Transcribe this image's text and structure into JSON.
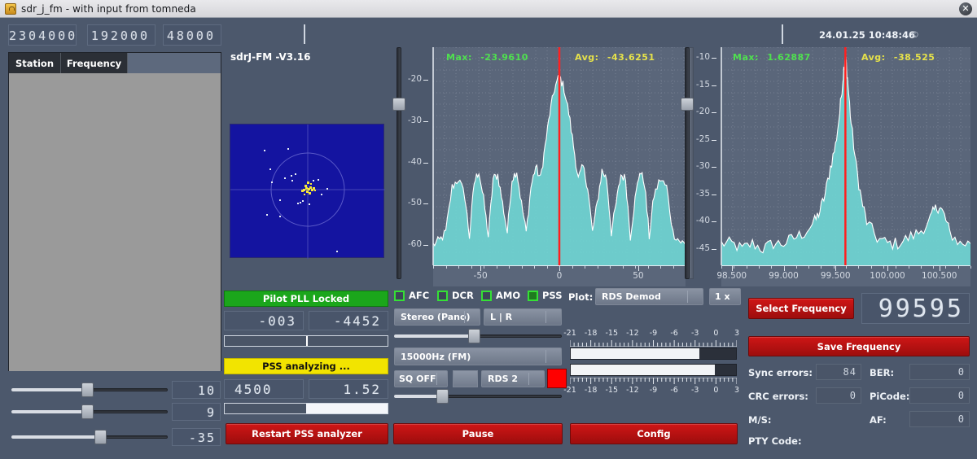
{
  "window": {
    "title": "sdr_j_fm - with input from tomneda",
    "close_label": "✕",
    "app_icon": "lock-icon"
  },
  "header": {
    "rate_displays": [
      "2304000",
      "192000",
      "48000"
    ],
    "version": "sdrJ-FM -V3.16",
    "datetime": "24.01.25 10:48:46",
    "copyright": "©"
  },
  "station_table": {
    "columns": [
      "Station",
      "Frequency"
    ],
    "rows": []
  },
  "left_sliders": [
    {
      "name": "slider-1",
      "value": "10",
      "pct": 47
    },
    {
      "name": "slider-2",
      "value": "9",
      "pct": 47
    },
    {
      "name": "slider-3",
      "value": "-35",
      "pct": 55
    }
  ],
  "constellation": {
    "label": "constellation-scope",
    "bg": "#1414a0",
    "point_color": "#f7e73a"
  },
  "status": {
    "pll": {
      "text": "Pilot PLL Locked",
      "color": "#1ba61b"
    },
    "pll_value_left": "-003",
    "pll_value_right": "-4452",
    "pll_bar_pct": 50,
    "pss": {
      "text": "PSS analyzing ...",
      "color": "#f2e400"
    },
    "pss_value_left": "4500",
    "pss_value_right": "1.52",
    "pss_bar_pct": 50
  },
  "toggles": [
    {
      "label": "AFC",
      "checked": false
    },
    {
      "label": "DCR",
      "checked": false
    },
    {
      "label": "AMO",
      "checked": false
    },
    {
      "label": "PSS",
      "checked": true
    }
  ],
  "plot_controls": {
    "plot_label": "Plot:",
    "plot_mode": "RDS Demod",
    "zoom": "1 x",
    "stereo_mode": "Stereo (Pano)",
    "channel_mode": "L | R",
    "filter": "15000Hz (FM)",
    "squelch": "SQ OFF",
    "rds_mode": "RDS 2",
    "rds_indicator_color": "#ff0000",
    "balance_pct": 45,
    "squelch_slider_pct": 26
  },
  "level_meters": {
    "tick_labels": [
      "-21",
      "-18",
      "-15",
      "-12",
      "-9",
      "-6",
      "-3",
      "0",
      "3"
    ],
    "left_pct": 78,
    "right_pct": 87
  },
  "frequency": {
    "select_label": "Select Frequency",
    "save_label": "Save Frequency",
    "display": "99595"
  },
  "rds_stats": [
    {
      "label": "Sync errors:",
      "value": "84"
    },
    {
      "label": "BER:",
      "value": "0"
    },
    {
      "label": "CRC errors:",
      "value": "0"
    },
    {
      "label": "PiCode:",
      "value": "0"
    },
    {
      "label": "M/S:",
      "value": ""
    },
    {
      "label": "AF:",
      "value": "0"
    },
    {
      "label": "PTY Code:",
      "value": ""
    }
  ],
  "actions": {
    "restart": "Restart PSS analyzer",
    "pause": "Pause",
    "config": "Config"
  },
  "chart_data": [
    {
      "type": "area",
      "name": "baseband-spectrum",
      "title": "",
      "xlabel": "",
      "ylabel": "",
      "stat_max_label": "Max:",
      "stat_max_value": "-23.9610",
      "stat_avg_label": "Avg:",
      "stat_avg_value": "-43.6251",
      "xlim": [
        -80,
        80
      ],
      "ylim": [
        -65,
        -12
      ],
      "xticks": [
        -50,
        0,
        50
      ],
      "yticks": [
        -20,
        -30,
        -40,
        -50,
        -60
      ],
      "grid": true,
      "marker_x": 0,
      "marker_color": "#ff2020",
      "fill_color": "#6fd9d6",
      "line_color": "#ffffff",
      "x": [
        -80,
        -76,
        -72,
        -68,
        -64,
        -60,
        -57,
        -54,
        -51,
        -48,
        -45,
        -42,
        -39,
        -36,
        -33,
        -30,
        -27,
        -24,
        -21,
        -18,
        -15,
        -12,
        -9,
        -6,
        -3,
        0,
        3,
        6,
        9,
        12,
        15,
        18,
        21,
        24,
        27,
        30,
        33,
        36,
        39,
        42,
        45,
        48,
        51,
        54,
        57,
        60,
        64,
        68,
        72,
        76,
        80
      ],
      "y": [
        -60,
        -59,
        -57,
        -46,
        -44,
        -48,
        -58,
        -45,
        -42,
        -49,
        -58,
        -44,
        -43,
        -50,
        -57,
        -44,
        -42,
        -50,
        -57,
        -46,
        -41,
        -44,
        -36,
        -28,
        -22,
        -19,
        -22,
        -28,
        -36,
        -44,
        -41,
        -46,
        -57,
        -50,
        -42,
        -44,
        -57,
        -50,
        -43,
        -44,
        -58,
        -49,
        -42,
        -45,
        -58,
        -48,
        -44,
        -46,
        -57,
        -59,
        -60
      ]
    },
    {
      "type": "area",
      "name": "rf-spectrum",
      "title": "",
      "xlabel": "",
      "ylabel": "",
      "stat_max_label": "Max:",
      "stat_max_value": "1.62887",
      "stat_avg_label": "Avg:",
      "stat_avg_value": "-38.525",
      "xlim": [
        98.4,
        100.8
      ],
      "ylim": [
        -48,
        -8
      ],
      "xticks": [
        "98.500",
        "99.000",
        "99.500",
        "100.000",
        "100.500"
      ],
      "yticks": [
        -10,
        -15,
        -20,
        -25,
        -30,
        -35,
        -40,
        -45
      ],
      "grid": true,
      "marker_x": 99.595,
      "marker_color": "#ff2020",
      "fill_color": "#6fd9d6",
      "line_color": "#ffffff",
      "x": [
        98.4,
        98.5,
        98.6,
        98.7,
        98.8,
        98.9,
        99.0,
        99.1,
        99.2,
        99.3,
        99.35,
        99.4,
        99.45,
        99.5,
        99.54,
        99.57,
        99.59,
        99.595,
        99.6,
        99.62,
        99.65,
        99.7,
        99.75,
        99.8,
        99.9,
        100.0,
        100.1,
        100.2,
        100.3,
        100.4,
        100.45,
        100.5,
        100.55,
        100.6,
        100.7,
        100.8
      ],
      "y": [
        -44,
        -44,
        -45,
        -44,
        -45,
        -44,
        -44,
        -43,
        -42,
        -40,
        -38,
        -35,
        -30,
        -26,
        -20,
        -14,
        -10,
        -9,
        -10,
        -15,
        -22,
        -30,
        -36,
        -40,
        -43,
        -44,
        -44,
        -43,
        -42,
        -40,
        -38,
        -37,
        -39,
        -42,
        -44,
        -44
      ]
    }
  ]
}
